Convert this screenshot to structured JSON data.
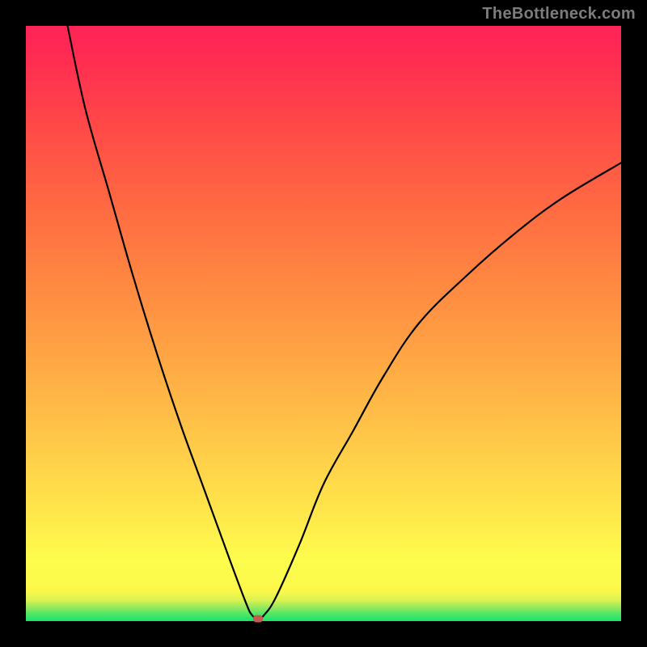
{
  "watermark": "TheBottleneck.com",
  "chart_data": {
    "type": "line",
    "title": "",
    "xlabel": "",
    "ylabel": "",
    "xlim": [
      0,
      100
    ],
    "ylim": [
      0,
      100
    ],
    "grid": false,
    "legend": false,
    "series": [
      {
        "name": "bottleneck-curve",
        "color": "#000000",
        "x": [
          7,
          10,
          14,
          18,
          22,
          26,
          30,
          34,
          37,
          38,
          39,
          40,
          42,
          46,
          50,
          55,
          60,
          66,
          74,
          82,
          90,
          100
        ],
        "y": [
          100,
          86,
          72,
          58,
          45,
          33,
          22,
          11,
          3,
          1,
          0.4,
          1,
          4,
          13,
          23,
          32,
          41,
          50,
          58,
          65,
          71,
          77
        ]
      }
    ],
    "marker": {
      "x": 39,
      "y": 0.4,
      "color": "#c55a50"
    },
    "background_gradient": {
      "type": "vertical",
      "stops": [
        {
          "pos": 0.0,
          "color": "#19e36a"
        },
        {
          "pos": 0.05,
          "color": "#fdfd4d"
        },
        {
          "pos": 0.45,
          "color": "#ffa444"
        },
        {
          "pos": 1.0,
          "color": "#ff2458"
        }
      ]
    }
  }
}
